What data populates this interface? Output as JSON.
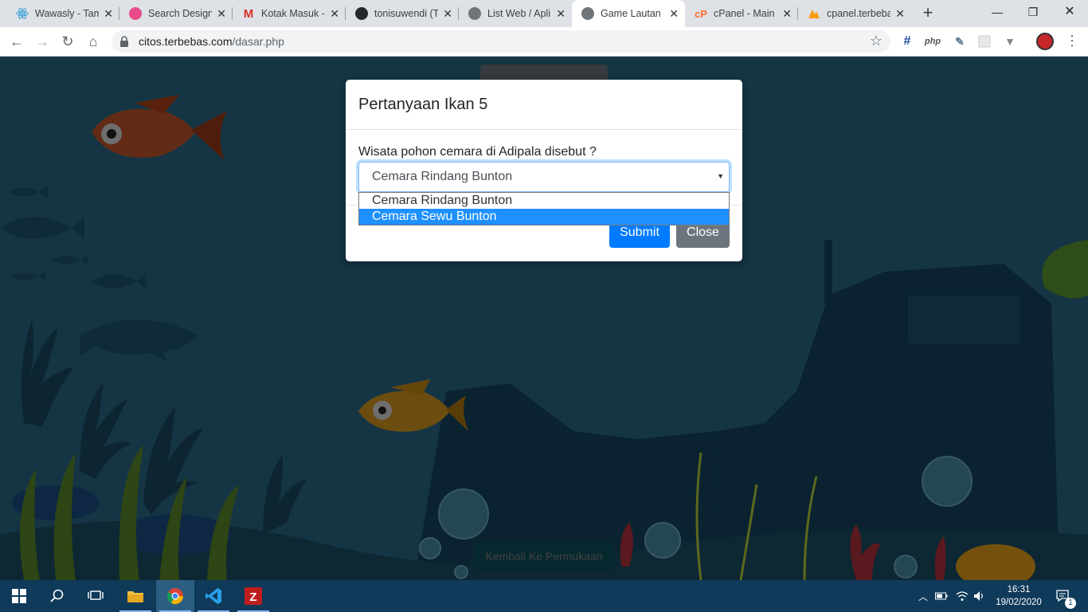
{
  "browser": {
    "tabs": [
      {
        "title": "Wawasly - Tam",
        "icon": "react-icon",
        "color": "#61dafb"
      },
      {
        "title": "Search Design",
        "icon": "dribbble-icon",
        "color": "#ea4c89"
      },
      {
        "title": "Kotak Masuk -",
        "icon": "gmail-icon",
        "color": "#d93025"
      },
      {
        "title": "tonisuwendi (T",
        "icon": "github-icon",
        "color": "#24292e"
      },
      {
        "title": "List Web / Apli",
        "icon": "globe-icon",
        "color": "#5f6368"
      },
      {
        "title": "Game Lautan",
        "icon": "globe-icon",
        "color": "#5f6368"
      },
      {
        "title": "cPanel - Main",
        "icon": "cpanel-icon",
        "color": "#ff6c2c"
      },
      {
        "title": "cpanel.terbeba",
        "icon": "phpmyadmin-icon",
        "color": "#f89c0e"
      }
    ],
    "url_host": "citos.terbebas.com",
    "url_path": "/dasar.php"
  },
  "modal": {
    "title": "Pertanyaan Ikan 5",
    "question": "Wisata pohon cemara di Adipala disebut ?",
    "selected": "Cemara Rindang Bunton",
    "options": [
      "Cemara Rindang Bunton",
      "Cemara Sewu Bunton"
    ],
    "highlighted_option": "Cemara Sewu Bunton",
    "submit_label": "Submit",
    "close_label": "Close"
  },
  "page": {
    "return_button": "Kembali Ke Permukaan"
  },
  "taskbar": {
    "time": "16:31",
    "date": "19/02/2020",
    "notification_count": "1"
  },
  "colors": {
    "primary": "#007bff",
    "secondary": "#6c757d",
    "info": "#17a2b8",
    "sea": "#245b76"
  }
}
